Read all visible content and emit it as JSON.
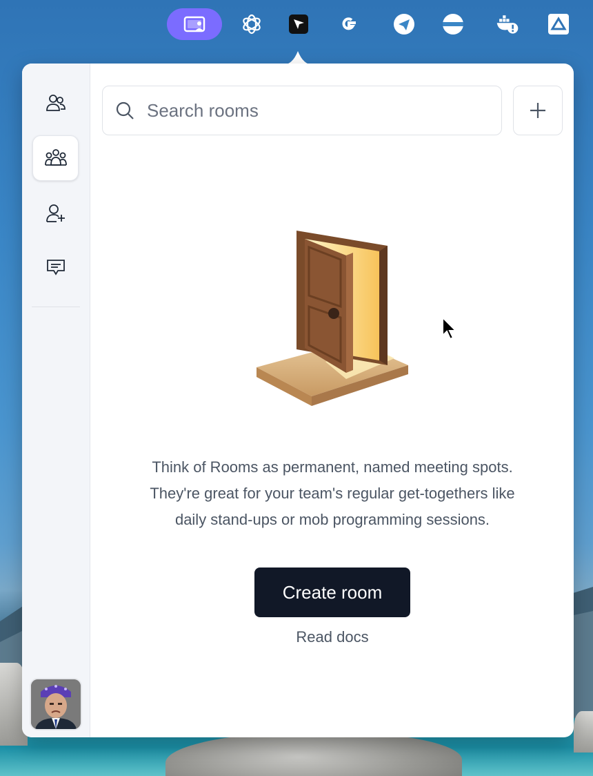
{
  "menubar": {
    "items": [
      {
        "icon": "screen-share-icon",
        "active": true
      },
      {
        "icon": "openai-icon"
      },
      {
        "icon": "cursor-app-icon"
      },
      {
        "icon": "google-icon"
      },
      {
        "icon": "telegram-icon"
      },
      {
        "icon": "expressvpn-icon"
      },
      {
        "icon": "docker-warning-icon"
      },
      {
        "icon": "drive-upload-icon"
      }
    ],
    "active_color": "#7b6cff"
  },
  "sidebar": {
    "items": [
      {
        "icon": "contacts-icon",
        "active": false
      },
      {
        "icon": "rooms-icon",
        "active": true
      },
      {
        "icon": "add-user-icon",
        "active": false
      },
      {
        "icon": "chat-icon",
        "active": false
      }
    ],
    "avatar_icon": "user-avatar"
  },
  "search": {
    "placeholder": "Search rooms",
    "value": ""
  },
  "empty_state": {
    "illustration": "open-door-illustration",
    "description_lines": [
      "Think of Rooms as permanent, named meeting spots.",
      "They're great for your team's regular get-togethers like",
      "daily stand-ups or mob programming sessions."
    ],
    "primary_button": "Create room",
    "secondary_link": "Read docs"
  },
  "colors": {
    "primary_button_bg": "#111827",
    "text_muted": "#4b5563",
    "sidebar_bg": "#f3f5f9"
  }
}
